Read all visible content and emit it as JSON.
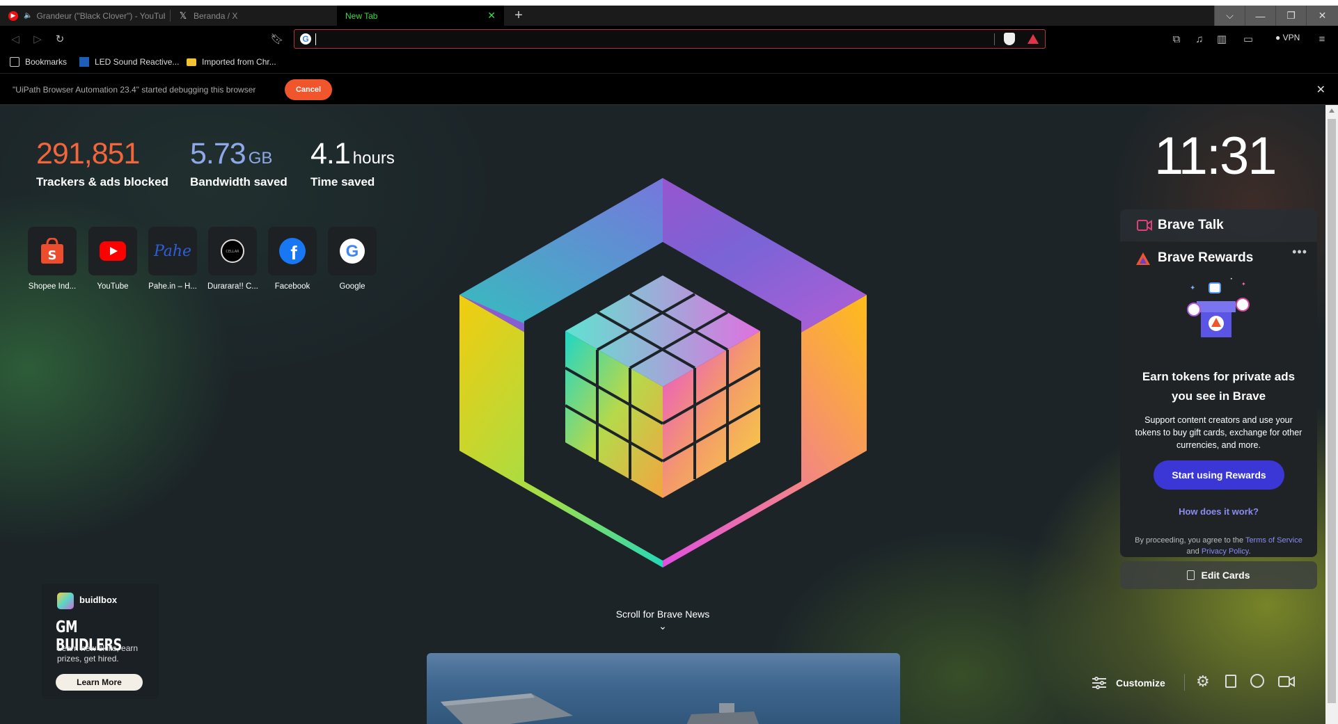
{
  "tabs": [
    {
      "label": "Grandeur (\"Black Clover\") - YouTub",
      "favicon": "youtube-icon"
    },
    {
      "label": "Beranda / X",
      "favicon": "x-icon"
    },
    {
      "label": "New Tab",
      "active": true
    }
  ],
  "bookmarks": [
    {
      "label": "Bookmarks",
      "icon": "bookmarks-icon"
    },
    {
      "label": "LED Sound Reactive...",
      "icon": "site-icon"
    },
    {
      "label": "Imported from Chr...",
      "icon": "folder-icon"
    }
  ],
  "toolbar": {
    "vpn": "VPN",
    "url_value": ""
  },
  "debug": {
    "message": "\"UiPath Browser Automation 23.4\" started debugging this browser",
    "cancel": "Cancel"
  },
  "stats": {
    "trackers": {
      "value": "291,851",
      "label": "Trackers & ads blocked"
    },
    "bandwidth": {
      "value": "5.73",
      "unit": "GB",
      "label": "Bandwidth saved"
    },
    "time": {
      "value": "4.1",
      "unit": "hours",
      "label": "Time saved"
    }
  },
  "top_sites": [
    {
      "label": "Shopee Ind..."
    },
    {
      "label": "YouTube"
    },
    {
      "label": "Pahe.in – H..."
    },
    {
      "label": "Durarara!! C..."
    },
    {
      "label": "Facebook"
    },
    {
      "label": "Google"
    }
  ],
  "clock": "11:31",
  "brave_talk": {
    "title": "Brave Talk"
  },
  "brave_rewards": {
    "title": "Brave Rewards",
    "headline": "Earn tokens for private ads you see in Brave",
    "description": "Support content creators and use your tokens to buy gift cards, exchange for other currencies, and more.",
    "start_button": "Start using Rewards",
    "how_link": "How does it work?",
    "terms_prefix": "By proceeding, you agree to the",
    "terms_link": "Terms of Service",
    "terms_and": "and",
    "privacy_link": "Privacy Policy",
    "terms_suffix": "."
  },
  "edit_cards": "Edit Cards",
  "sponsor": {
    "brand": "buidlbox",
    "headline": "GM BUIDLERS",
    "subtext": "Learn new skills, earn prizes, get hired.",
    "button": "Learn More"
  },
  "scroll_news": "Scroll for Brave News",
  "customize": "Customize",
  "colors": {
    "accent": "#f0552c",
    "rewards_button": "#3a37d6",
    "link": "#8c8cf0",
    "tracker_number": "#f3653a",
    "bandwidth_number": "#8fa8e8"
  }
}
